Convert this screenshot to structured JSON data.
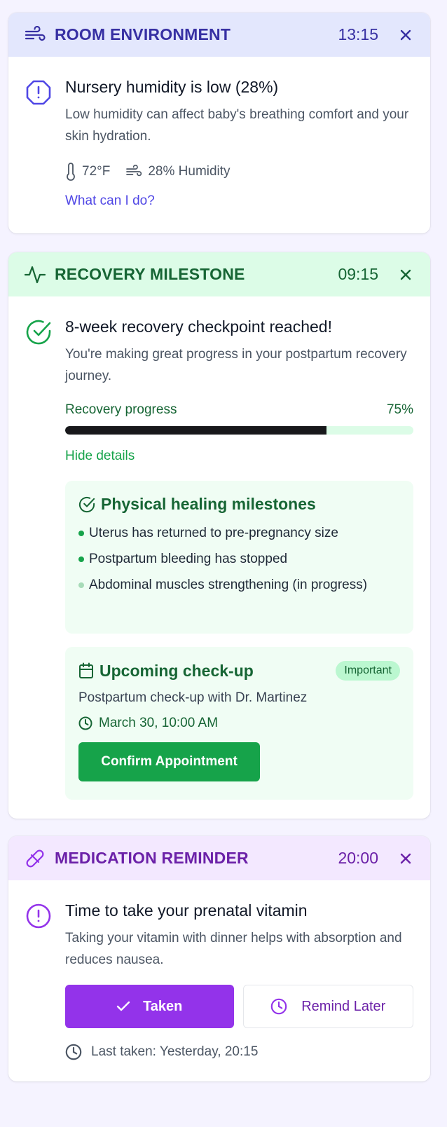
{
  "colors": {
    "room_accent": "#3730a3",
    "room_header_bg": "#e3e7fd",
    "recovery_accent": "#166534",
    "recovery_header_bg": "#dcfce7",
    "medication_accent": "#6b21a8",
    "medication_header_bg": "#f3e8ff",
    "progress_fill": "#18181b",
    "confirm_button": "#16a34a",
    "taken_button": "#9333ea"
  },
  "room": {
    "header_icon": "wind-icon",
    "title": "ROOM ENVIRONMENT",
    "time": "13:15",
    "alert_icon": "alert-octagon-icon",
    "message_title": "Nursery humidity is low (28%)",
    "message_desc": "Low humidity can affect baby's breathing comfort and your skin hydration.",
    "temperature": "72°F",
    "humidity": "28% Humidity",
    "link": "What can I do?"
  },
  "recovery": {
    "header_icon": "activity-icon",
    "title": "RECOVERY MILESTONE",
    "time": "09:15",
    "alert_icon": "check-circle-icon",
    "message_title": "8-week recovery checkpoint reached!",
    "message_desc": "You're making great progress in your postpartum recovery journey.",
    "progress_label": "Recovery progress",
    "progress_text": "75%",
    "progress_value": 0.75,
    "toggle_link": "Hide details",
    "milestones_title": "Physical healing milestones",
    "milestones": [
      {
        "text": "Uterus has returned to pre-pregnancy size",
        "status": "done"
      },
      {
        "text": "Postpartum bleeding has stopped",
        "status": "done"
      },
      {
        "text": "Abdominal muscles strengthening (in progress)",
        "status": "in-progress"
      }
    ],
    "checkup_title": "Upcoming check-up",
    "checkup_badge": "Important",
    "checkup_desc": "Postpartum check-up with Dr. Martinez",
    "checkup_time": "March 30, 10:00 AM",
    "confirm_label": "Confirm Appointment"
  },
  "medication": {
    "header_icon": "pill-icon",
    "title": "MEDICATION REMINDER",
    "time": "20:00",
    "alert_icon": "alert-circle-icon",
    "message_title": "Time to take your prenatal vitamin",
    "message_desc": "Taking your vitamin with dinner helps with absorption and reduces nausea.",
    "taken_label": "Taken",
    "later_label": "Remind Later",
    "last_taken": "Last taken: Yesterday, 20:15"
  }
}
